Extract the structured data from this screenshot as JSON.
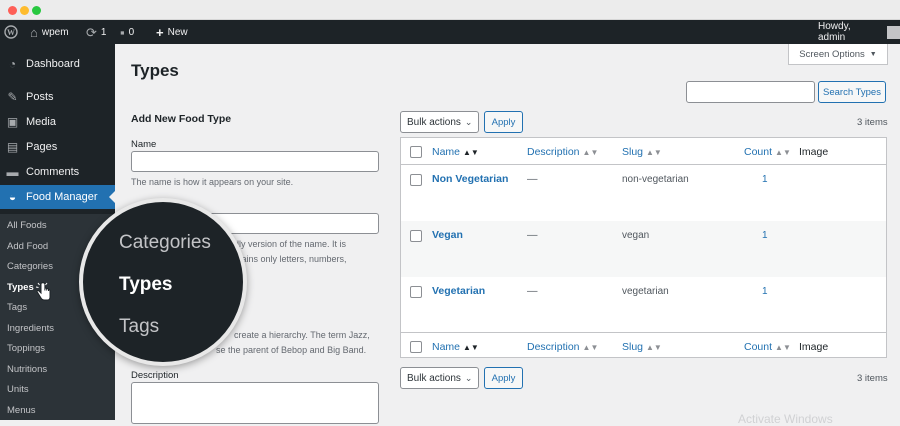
{
  "admin_bar": {
    "site_name": "wpem",
    "updates_count": "1",
    "comments_count": "0",
    "new_label": "New",
    "greeting": "Howdy, admin"
  },
  "sidebar": {
    "items": [
      {
        "label": "Dashboard",
        "icon": "dashboard-icon"
      },
      {
        "label": "Posts",
        "icon": "pushpin-icon"
      },
      {
        "label": "Media",
        "icon": "media-icon"
      },
      {
        "label": "Pages",
        "icon": "page-icon"
      },
      {
        "label": "Comments",
        "icon": "comment-icon"
      },
      {
        "label": "Food Manager",
        "icon": "food-manager-icon"
      }
    ],
    "submenu": [
      "All Foods",
      "Add Food",
      "Categories",
      "Types",
      "Tags",
      "Ingredients",
      "Toppings",
      "Nutritions",
      "Units",
      "Menus"
    ],
    "current_submenu": "Types"
  },
  "zoom_callout": {
    "items": [
      "Categories",
      "Types",
      "Tags"
    ],
    "current": "Types"
  },
  "screen_options_label": "Screen Options",
  "page_title": "Types",
  "add_form": {
    "heading": "Add New Food Type",
    "name_label": "Name",
    "name_help": "The name is how it appears on your site.",
    "slug_help_line1": "dly version of the name. It is",
    "slug_help_line2": "ntains only letters, numbers,",
    "parent_help_line1": "create a hierarchy. The term Jazz,",
    "parent_help_line2": "se the parent of Bebop and Big Band.",
    "description_label": "Description"
  },
  "search": {
    "value": "",
    "button_label": "Search Types"
  },
  "bulk": {
    "select_label": "Bulk actions",
    "apply_label": "Apply"
  },
  "item_count": "3 items",
  "table": {
    "headers": {
      "name": "Name",
      "description": "Description",
      "slug": "Slug",
      "count": "Count",
      "image": "Image"
    },
    "rows": [
      {
        "name": "Non Vegetarian",
        "description": "—",
        "slug": "non-vegetarian",
        "count": "1"
      },
      {
        "name": "Vegan",
        "description": "—",
        "slug": "vegan",
        "count": "1"
      },
      {
        "name": "Vegetarian",
        "description": "—",
        "slug": "vegetarian",
        "count": "1"
      }
    ]
  },
  "watermark": "Activate Windows",
  "colors": {
    "admin_dark": "#1d2327",
    "accent_blue": "#2271b1",
    "page_bg": "#f0f0f1"
  }
}
